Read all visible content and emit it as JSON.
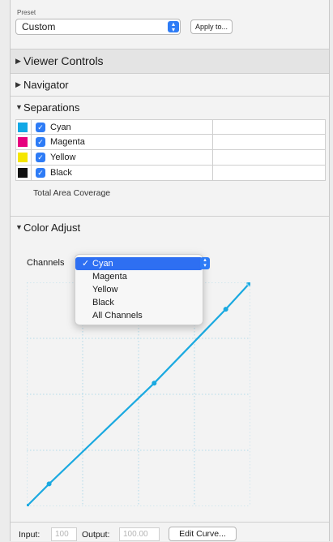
{
  "preset": {
    "label": "Preset",
    "value": "Custom",
    "apply_button": "Apply to..."
  },
  "sections": {
    "viewer_controls": "Viewer Controls",
    "navigator": "Navigator",
    "separations": "Separations",
    "color_adjust": "Color Adjust"
  },
  "separations": [
    {
      "name": "Cyan",
      "color": "#12a8e6",
      "checked": true
    },
    {
      "name": "Magenta",
      "color": "#e6007e",
      "checked": true
    },
    {
      "name": "Yellow",
      "color": "#f5e600",
      "checked": true
    },
    {
      "name": "Black",
      "color": "#111111",
      "checked": true
    }
  ],
  "total_area_coverage": "Total Area Coverage",
  "channels": {
    "label": "Channels",
    "options": [
      "Cyan",
      "Magenta",
      "Yellow",
      "Black",
      "All Channels"
    ],
    "selected": "Cyan"
  },
  "curve": {
    "color": "#1aa9e0",
    "grid_divisions": 4,
    "points": [
      [
        0,
        0
      ],
      [
        10,
        10
      ],
      [
        57,
        55
      ],
      [
        89,
        88
      ],
      [
        100,
        100
      ]
    ]
  },
  "io": {
    "input_label": "Input:",
    "input_value": "100",
    "output_label": "Output:",
    "output_value": "100.00",
    "edit_button": "Edit Curve..."
  }
}
